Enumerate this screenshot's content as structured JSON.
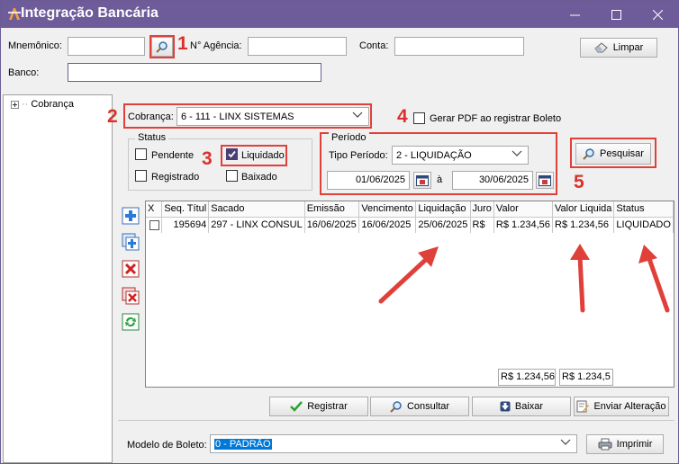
{
  "window": {
    "title": "Integração Bancária"
  },
  "fields": {
    "mnemonico_label": "Mnemônico:",
    "agencia_label": "N° Agência:",
    "conta_label": "Conta:",
    "banco_label": "Banco:",
    "limpar_label": "Limpar"
  },
  "tree": {
    "item_label": "Cobrança"
  },
  "filters": {
    "cobranca_label": "Cobrança:",
    "cobranca_value": "6 - 111 - LINX SISTEMAS",
    "gerar_pdf_label": "Gerar PDF ao registrar Boleto",
    "status_title": "Status",
    "pendente_label": "Pendente",
    "liquidado_label": "Liquidado",
    "registrado_label": "Registrado",
    "baixado_label": "Baixado",
    "periodo_title": "Período",
    "tipo_periodo_label": "Tipo Período:",
    "tipo_periodo_value": "2 - LIQUIDAÇÃO",
    "date_from": "01/06/2025",
    "date_sep": "à",
    "date_to": "30/06/2025",
    "pesquisar_label": "Pesquisar"
  },
  "annotations": [
    "1",
    "2",
    "3",
    "4",
    "5"
  ],
  "grid": {
    "columns": [
      "X",
      "Seq. Títul",
      "Sacado",
      "Emissão",
      "Vencimento",
      "Liquidação",
      "Juro",
      "Valor",
      "Valor Liquida",
      "Status"
    ],
    "rows": [
      {
        "seq": "195694",
        "sacado": "297 - LINX CONSUL",
        "emissao": "16/06/2025",
        "vencimento": "16/06/2025",
        "liquidacao": "25/06/2025",
        "juro": "R$",
        "valor": "R$ 1.234,56",
        "valor_liquida": "R$ 1.234,56",
        "status": "LIQUIDADO"
      }
    ],
    "total_valor": "R$ 1.234,56",
    "total_liquida": "R$ 1.234,5"
  },
  "actions": {
    "registrar": "Registrar",
    "consultar": "Consultar",
    "baixar": "Baixar",
    "enviar_alteracao": "Enviar Alteração"
  },
  "footer": {
    "modelo_label": "Modelo de Boleto:",
    "modelo_value": "0 - PADRÃO",
    "imprimir_label": "Imprimir"
  },
  "colors": {
    "titlebar": "#6e5b9a",
    "annotation": "#e0403a",
    "selection": "#0078d7"
  }
}
